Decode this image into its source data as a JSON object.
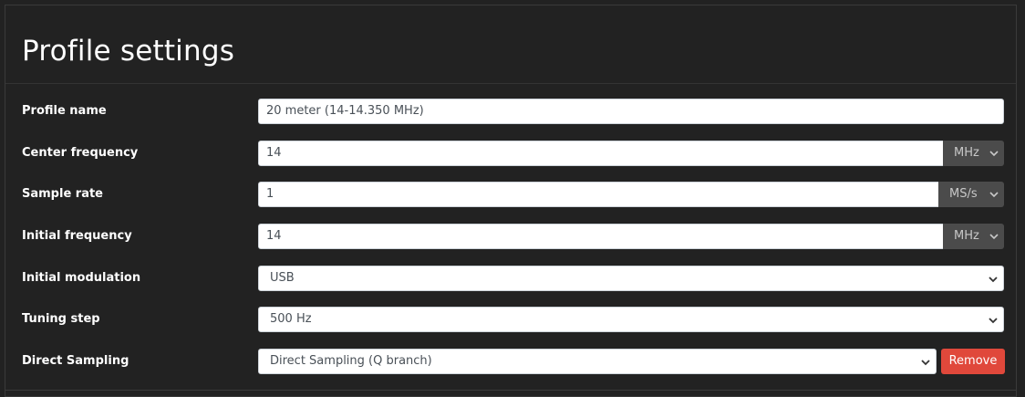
{
  "page": {
    "title": "Profile settings"
  },
  "fields": {
    "profile_name": {
      "label": "Profile name",
      "value": "20 meter (14-14.350 MHz)"
    },
    "center_frequency": {
      "label": "Center frequency",
      "value": "14",
      "unit": "MHz"
    },
    "sample_rate": {
      "label": "Sample rate",
      "value": "1",
      "unit": "MS/s"
    },
    "initial_frequency": {
      "label": "Initial frequency",
      "value": "14",
      "unit": "MHz"
    },
    "initial_modulation": {
      "label": "Initial modulation",
      "value": "USB"
    },
    "tuning_step": {
      "label": "Tuning step",
      "value": "500 Hz"
    },
    "direct_sampling": {
      "label": "Direct Sampling",
      "value": "Direct Sampling (Q branch)",
      "remove_label": "Remove"
    }
  },
  "icons": {
    "dropdown": "chevron-down-icon"
  },
  "colors": {
    "background": "#222222",
    "remove_button": "#e0483b",
    "unit_select": "#4b4b4b"
  }
}
